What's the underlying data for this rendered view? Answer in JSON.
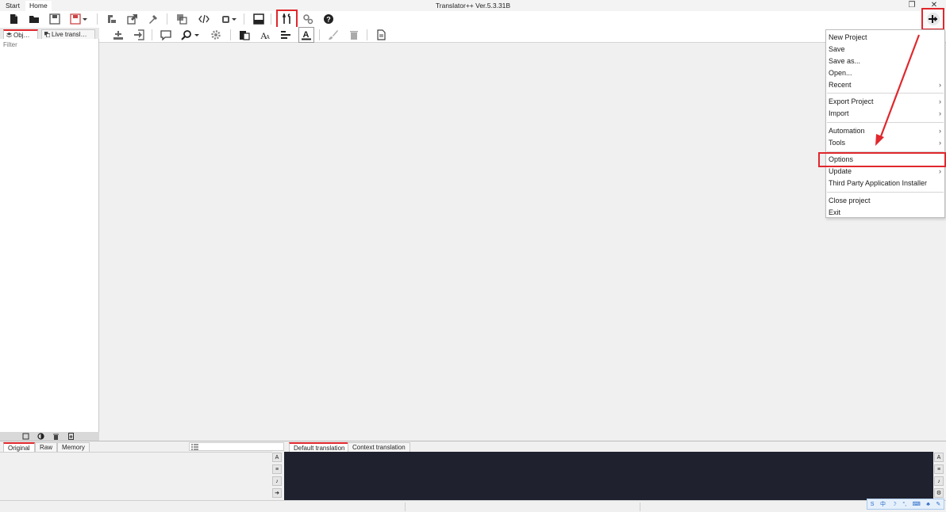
{
  "window": {
    "title": "Translator++ Ver.5.3.31B",
    "tabs": [
      "Start",
      "Home"
    ],
    "controls": {
      "restore": "❐",
      "close": "✕"
    }
  },
  "left_panel": {
    "tabs": [
      {
        "label": "Obj…",
        "icon": "layers-icon"
      },
      {
        "label": "Live transl…",
        "icon": "copy-icon"
      }
    ],
    "filter_placeholder": "Filter"
  },
  "bottom": {
    "tabs_left": [
      "Original",
      "Raw",
      "Memory"
    ],
    "tabs_right": [
      "Default translation",
      "Context translation"
    ]
  },
  "menu": {
    "items": [
      {
        "label": "New Project",
        "arrow": ""
      },
      {
        "label": "Save",
        "arrow": ""
      },
      {
        "label": "Save as...",
        "arrow": ""
      },
      {
        "label": "Open...",
        "arrow": ""
      },
      {
        "label": "Recent",
        "arrow": "›"
      },
      {
        "label": "Export Project",
        "arrow": "›"
      },
      {
        "label": "Import",
        "arrow": "›"
      },
      {
        "label": "Automation",
        "arrow": "›"
      },
      {
        "label": "Tools",
        "arrow": "›"
      },
      {
        "label": "Options",
        "arrow": ""
      },
      {
        "label": "Update",
        "arrow": "›"
      },
      {
        "label": "Third Party Application Installer",
        "arrow": ""
      },
      {
        "label": "Close project",
        "arrow": ""
      },
      {
        "label": "Exit",
        "arrow": ""
      }
    ]
  },
  "ime_bar": {
    "items": [
      "S",
      "中",
      "☽",
      "°,",
      "⌨",
      "♣",
      "✎"
    ]
  },
  "colors": {
    "highlight": "#e0282d",
    "dark_pane": "#20212e",
    "menu_bg": "#ffffff"
  }
}
